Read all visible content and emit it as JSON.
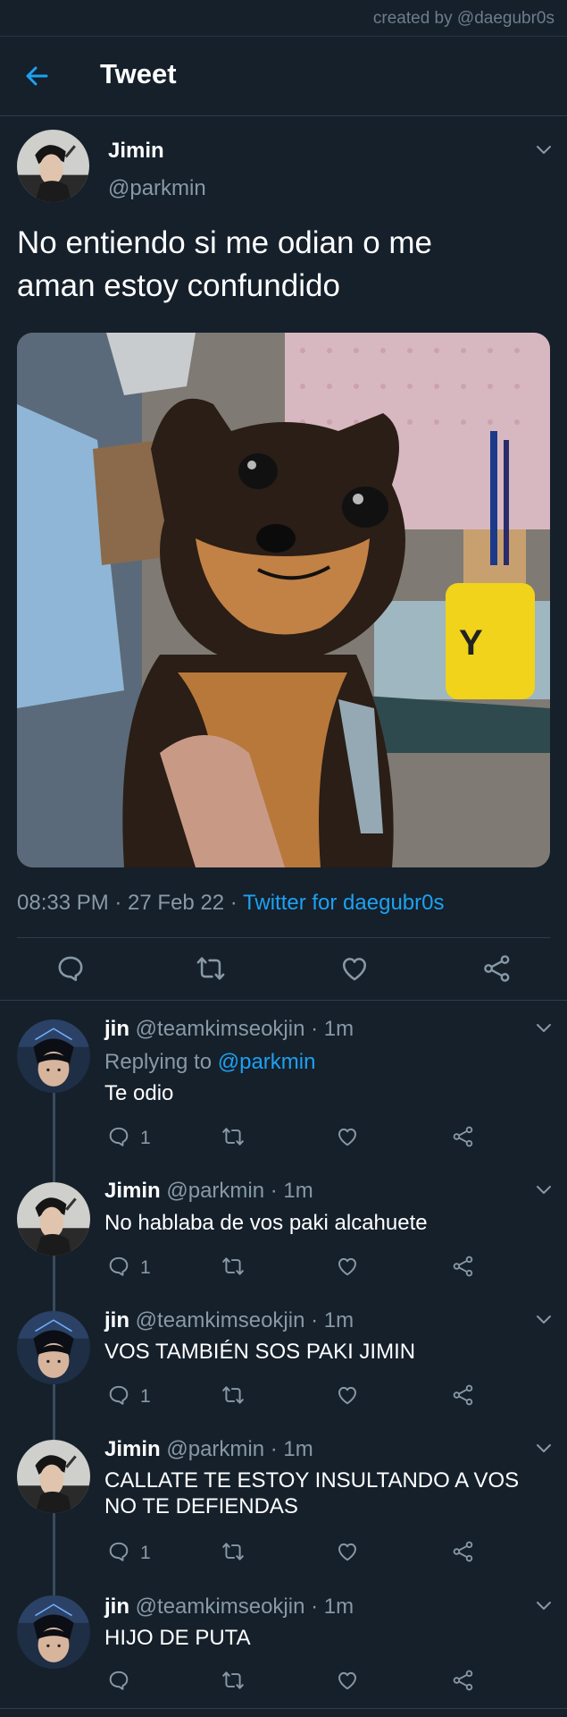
{
  "credit": "created by @daegubr0s",
  "header": {
    "title": "Tweet",
    "back_icon": "arrow-left-icon"
  },
  "colors": {
    "background": "#15202b",
    "accent": "#1da1f2",
    "muted": "#8899a6"
  },
  "tweet": {
    "name": "Jimin",
    "handle": "@parkmin",
    "text": "No entiendo si me odian o me aman estoy confundido",
    "time": "08:33 PM · 27 Feb 22 · ",
    "source": "Twitter for daegubr0s"
  },
  "replies": [
    {
      "name": "jin",
      "handle": "@teamkimseokjin · 1m",
      "replying_label": "Replying to ",
      "replying_to": "@parkmin",
      "text": "Te odio",
      "reply_count": "1"
    },
    {
      "name": "Jimin",
      "handle": "@parkmin · 1m",
      "text": "No hablaba de vos paki alcahuete",
      "reply_count": "1"
    },
    {
      "name": "jin",
      "handle": "@teamkimseokjin · 1m",
      "text": "VOS TAMBIÉN SOS PAKI JIMIN",
      "reply_count": "1"
    },
    {
      "name": "Jimin",
      "handle": "@parkmin · 1m",
      "text": "CALLATE TE ESTOY INSULTANDO A VOS NO TE DEFIENDAS",
      "reply_count": "1"
    },
    {
      "name": "jin",
      "handle": "@teamkimseokjin · 1m",
      "text": "HIJO DE PUTA",
      "reply_count": ""
    }
  ]
}
